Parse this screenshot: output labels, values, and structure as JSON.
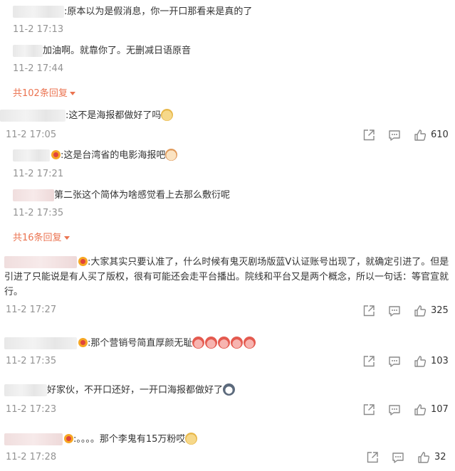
{
  "replies_block_1": [
    {
      "text": ":原本以为是假消息，你一开口那看来是真的了",
      "time": "11-2 17:13"
    },
    {
      "text": "加油啊。就靠你了。无删减日语原音",
      "time": "11-2 17:44"
    }
  ],
  "more_replies_1": "共102条回复",
  "comment_1": {
    "text": ":这不是海报都做好了吗",
    "emoji": "doge-emoji",
    "time": "11-2 17:05",
    "likes": "610"
  },
  "replies_block_2": [
    {
      "text": ":这是台湾省的电影海报吧",
      "emoji": "cat-emoji",
      "time": "11-2 17:21"
    },
    {
      "text": "第二张这个简体为啥感觉看上去那么敷衍呢",
      "time": "11-2 17:35"
    }
  ],
  "more_replies_2": "共16条回复",
  "comment_2": {
    "text": ":大家其实只要认准了，什么时候有鬼灭剧场版蓝V认证账号出现了，就确定引进了。但是引进了只能说是有人买了版权，很有可能还会走平台播出。院线和平台又是两个概念，所以一句话：等官宣就行。",
    "time": "11-2 17:27",
    "likes": "325"
  },
  "comment_3": {
    "text": ":那个营销号简直厚颜无耻",
    "emoji": "angry-emoji",
    "time": "11-2 17:35",
    "likes": "103"
  },
  "comment_4": {
    "text": "好家伙，不开口还好，一开口海报都做好了",
    "emoji": "husky-emoji",
    "time": "11-2 17:23",
    "likes": "107"
  },
  "comment_5": {
    "text": ":。。。。那个李鬼有15万粉哎",
    "emoji": "doge-emoji",
    "time": "11-2 17:28",
    "likes": "32"
  },
  "colors": {
    "accent": "#eb7350",
    "muted": "#939393",
    "text": "#333333"
  },
  "icons": [
    "share-icon",
    "comment-icon",
    "like-icon"
  ]
}
